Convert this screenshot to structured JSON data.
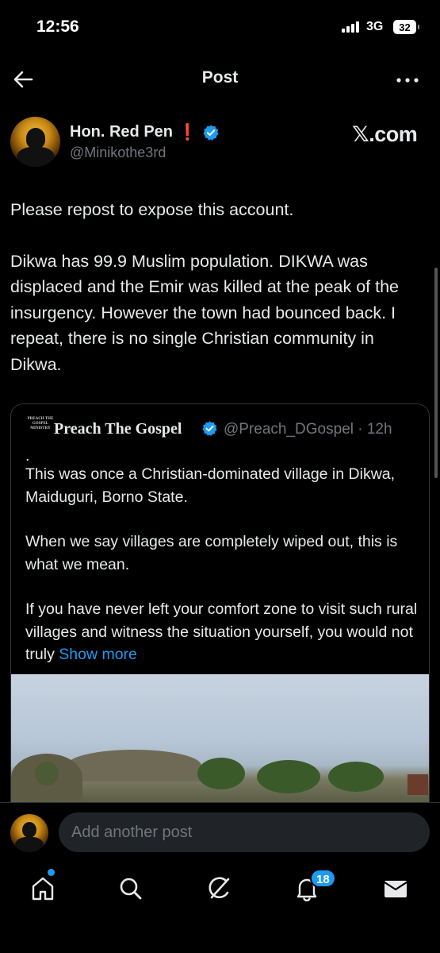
{
  "status_bar": {
    "time": "12:56",
    "network": "3G",
    "battery": "32"
  },
  "header": {
    "title": "Post"
  },
  "post": {
    "author_name": "Hon. Red Pen",
    "author_emoji": "❗",
    "handle": "@Minikothe3rd",
    "watermark": "𝕏.com",
    "paragraphs": [
      "Please repost to expose this account.",
      "Dikwa has 99.9 Muslim population. DIKWA was displaced and the Emir was killed at the peak of the insurgency. However the town had bounced back. I repeat, there is no single Christian community in Dikwa."
    ]
  },
  "quote": {
    "avatar_text": "PREACH THE GOSPEL MINISTRY",
    "name": "Preach The Gospel",
    "handle_time": "@Preach_DGospel · 12h",
    "dot_line": ".",
    "paragraphs": [
      "This was once a Christian-dominated village in Dikwa, Maiduguri, Borno State.",
      "When we say villages are completely wiped out, this is what we mean."
    ],
    "last_paragraph": "If you have never left your comfort zone to visit such rural villages and witness the situation yourself, you would not truly",
    "show_more": "Show more"
  },
  "reply": {
    "placeholder": "Add another post"
  },
  "nav": {
    "notifications_badge": "18"
  },
  "colors": {
    "accent": "#1d9bf0",
    "background": "#000000",
    "text": "#e7e9ea",
    "muted": "#71767b",
    "alert": "#f4212e"
  },
  "icons": [
    "back-arrow-icon",
    "more-icon",
    "verified-icon",
    "home-icon",
    "search-icon",
    "grok-icon",
    "bell-icon",
    "mail-icon"
  ]
}
